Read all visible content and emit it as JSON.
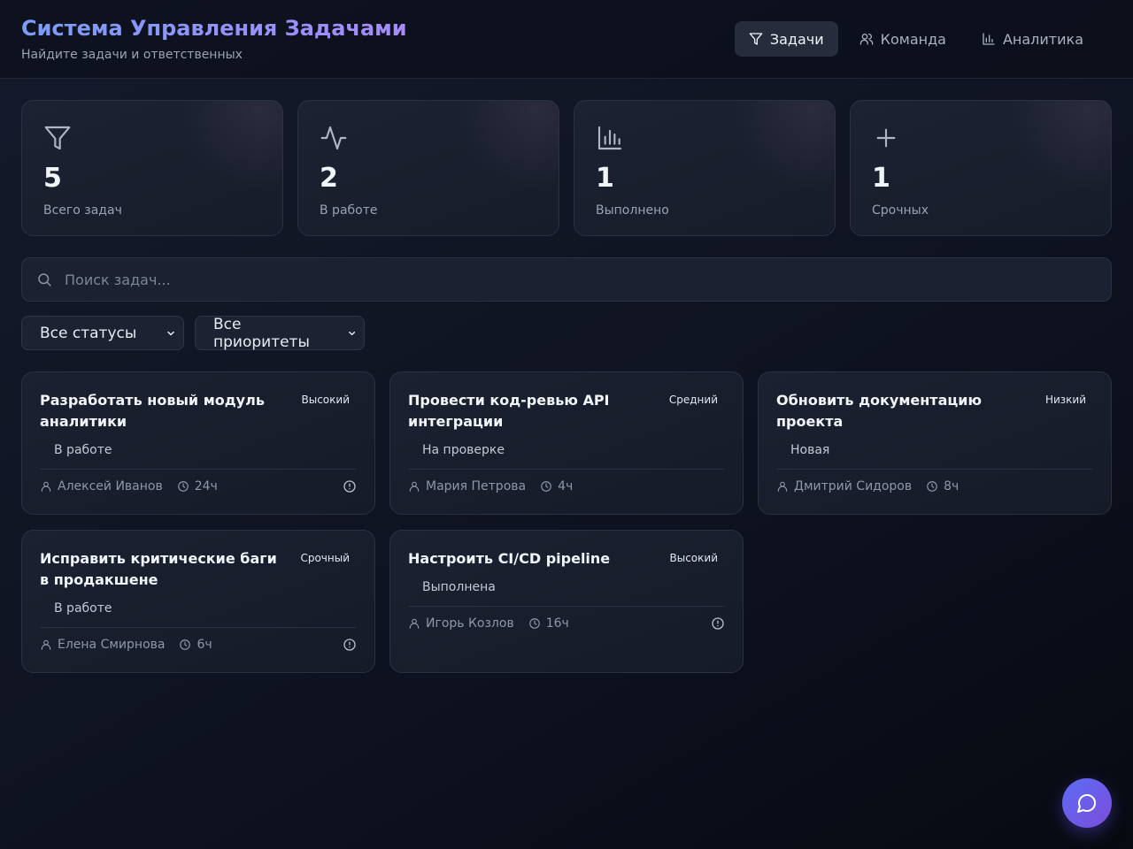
{
  "header": {
    "title": "Система Управления Задачами",
    "subtitle": "Найдите задачи и ответственных"
  },
  "nav": [
    {
      "label": "Задачи",
      "icon": "filter-icon",
      "active": true
    },
    {
      "label": "Команда",
      "icon": "users-icon",
      "active": false
    },
    {
      "label": "Аналитика",
      "icon": "bar-chart-icon",
      "active": false
    }
  ],
  "stats": [
    {
      "value": "5",
      "label": "Всего задач",
      "icon": "filter-icon"
    },
    {
      "value": "2",
      "label": "В работе",
      "icon": "activity-icon"
    },
    {
      "value": "1",
      "label": "Выполнено",
      "icon": "bar-chart-icon"
    },
    {
      "value": "1",
      "label": "Срочных",
      "icon": "plus-icon"
    }
  ],
  "search": {
    "placeholder": "Поиск задач...",
    "value": ""
  },
  "filters": {
    "status": "Все статусы",
    "priority": "Все приоритеты"
  },
  "tasks": [
    {
      "title": "Разработать новый модуль аналитики",
      "priority": "Высокий",
      "status": "В работе",
      "assignee": "Алексей Иванов",
      "hours": "24ч",
      "alert": true
    },
    {
      "title": "Провести код-ревью API интеграции",
      "priority": "Средний",
      "status": "На проверке",
      "assignee": "Мария Петрова",
      "hours": "4ч",
      "alert": false
    },
    {
      "title": "Обновить документацию проекта",
      "priority": "Низкий",
      "status": "Новая",
      "assignee": "Дмитрий Сидоров",
      "hours": "8ч",
      "alert": false
    },
    {
      "title": "Исправить критические баги в продакшене",
      "priority": "Срочный",
      "status": "В работе",
      "assignee": "Елена Смирнова",
      "hours": "6ч",
      "alert": true
    },
    {
      "title": "Настроить CI/CD pipeline",
      "priority": "Высокий",
      "status": "Выполнена",
      "assignee": "Игорь Козлов",
      "hours": "16ч",
      "alert": true
    }
  ],
  "colors": {
    "accent_start": "#7b9cf8",
    "accent_end": "#a78bfa",
    "fab_start": "#5b6cf5",
    "fab_end": "#7c4ddb"
  }
}
